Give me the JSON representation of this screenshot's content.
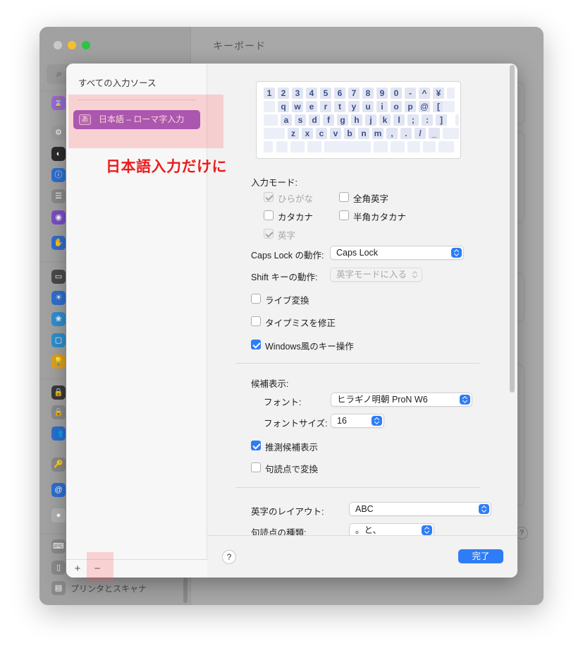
{
  "bg_window": {
    "title": "キーボード",
    "printer_label": "プリンタとスキャナ",
    "help_label": "?"
  },
  "sources_sheet": {
    "title": "すべての入力ソース",
    "selected_source": {
      "badge": "あ",
      "label": "日本語 – ローマ字入力"
    },
    "add_label": "+",
    "remove_label": "−"
  },
  "keyboard_rows": [
    [
      "1",
      "2",
      "3",
      "4",
      "5",
      "6",
      "7",
      "8",
      "9",
      "0",
      "-",
      "^",
      "¥"
    ],
    [
      "q",
      "w",
      "e",
      "r",
      "t",
      "y",
      "u",
      "i",
      "o",
      "p",
      "@",
      "["
    ],
    [
      "a",
      "s",
      "d",
      "f",
      "g",
      "h",
      "j",
      "k",
      "l",
      ";",
      ":",
      "]"
    ],
    [
      "z",
      "x",
      "c",
      "v",
      "b",
      "n",
      "m",
      ",",
      ".",
      "/",
      "_"
    ]
  ],
  "input_mode": {
    "heading": "入力モード:",
    "hiragana": "ひらがな",
    "zenkaku_eiji": "全角英字",
    "katakana": "カタカナ",
    "hankaku_katakana": "半角カタカナ",
    "eiji": "英字"
  },
  "caps_lock": {
    "label": "Caps Lock の動作:",
    "value": "Caps Lock"
  },
  "shift": {
    "label": "Shift キーの動作:",
    "value": "英字モードに入る"
  },
  "options": {
    "live_conversion": "ライブ変換",
    "typo_fix": "タイプミスを修正",
    "windows_keys": "Windows風のキー操作"
  },
  "candidates": {
    "heading": "候補表示:",
    "font_label": "フォント:",
    "font_value": "ヒラギノ明朝 ProN W6",
    "size_label": "フォントサイズ:",
    "size_value": "16",
    "predictive": "推測候補表示",
    "punct_convert": "句読点で変換"
  },
  "layout": {
    "label": "英字のレイアウト:",
    "value": "ABC"
  },
  "punct_type": {
    "label": "句読点の種類:",
    "value": "。と、"
  },
  "footer": {
    "help_label": "?",
    "done_label": "完了"
  },
  "annotation": {
    "text": "日本語入力だけに",
    "color": "#ec1c1c"
  },
  "colors": {
    "accent": "#2f7df6",
    "source_selected": "#9459c9"
  }
}
